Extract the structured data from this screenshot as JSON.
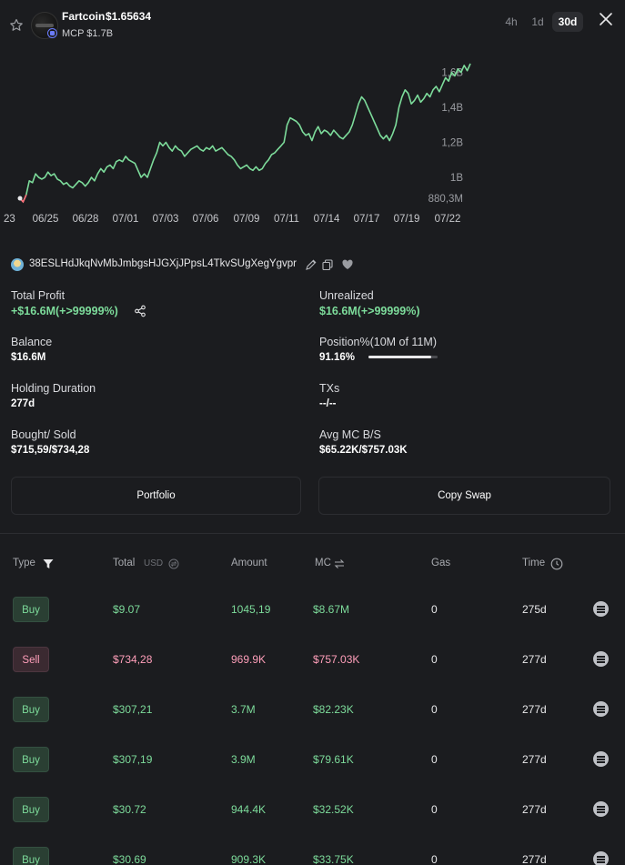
{
  "header": {
    "token_name": "Fartcoin",
    "price": "$1.65634",
    "mcp": "MCP $1.7B",
    "timeframes": [
      "4h",
      "1d",
      "30d"
    ],
    "active_timeframe": "30d"
  },
  "chart_data": {
    "type": "line",
    "x_ticks": [
      "23",
      "06/25",
      "06/28",
      "07/01",
      "07/03",
      "07/06",
      "07/09",
      "07/11",
      "07/14",
      "07/17",
      "07/19",
      "07/22"
    ],
    "y_ticks": [
      "1,6B",
      "1,4B",
      "1,2B",
      "1B",
      "880,3M"
    ],
    "ylim": [
      0.8803,
      1.65
    ],
    "line_color": "#7ddc9b",
    "start_color": "#ff6b7a",
    "values": [
      0.88,
      0.86,
      0.9,
      0.98,
      0.97,
      1.02,
      1.0,
      0.99,
      1.0,
      1.03,
      1.01,
      1.02,
      0.99,
      0.98,
      0.96,
      0.97,
      0.95,
      0.94,
      0.96,
      0.98,
      0.97,
      0.95,
      0.97,
      1.0,
      0.98,
      1.02,
      1.05,
      1.03,
      1.06,
      1.07,
      1.05,
      1.09,
      1.1,
      1.09,
      1.12,
      1.1,
      1.09,
      1.08,
      1.04,
      1.0,
      1.02,
      1.0,
      1.05,
      1.1,
      1.14,
      1.2,
      1.18,
      1.2,
      1.17,
      1.15,
      1.18,
      1.16,
      1.15,
      1.12,
      1.14,
      1.16,
      1.17,
      1.18,
      1.16,
      1.15,
      1.17,
      1.16,
      1.18,
      1.15,
      1.16,
      1.17,
      1.15,
      1.13,
      1.12,
      1.1,
      1.07,
      1.05,
      1.06,
      1.07,
      1.05,
      1.04,
      1.06,
      1.04,
      1.05,
      1.08,
      1.1,
      1.13,
      1.14,
      1.16,
      1.18,
      1.2,
      1.3,
      1.34,
      1.33,
      1.32,
      1.3,
      1.26,
      1.24,
      1.25,
      1.21,
      1.26,
      1.29,
      1.25,
      1.27,
      1.26,
      1.24,
      1.27,
      1.25,
      1.23,
      1.22,
      1.24,
      1.26,
      1.3,
      1.36,
      1.42,
      1.46,
      1.44,
      1.4,
      1.36,
      1.32,
      1.28,
      1.24,
      1.22,
      1.24,
      1.21,
      1.25,
      1.3,
      1.4,
      1.46,
      1.5,
      1.48,
      1.42,
      1.44,
      1.47,
      1.43,
      1.45,
      1.48,
      1.46,
      1.5,
      1.52,
      1.49,
      1.53,
      1.57,
      1.55,
      1.6,
      1.58,
      1.62,
      1.6,
      1.64,
      1.61,
      1.65
    ]
  },
  "wallet": {
    "address": "38ESLHdJkqNvMbJmbgsHJGXjJPpsL4TkvSUgXegYgvpr"
  },
  "stats": {
    "total_profit_label": "Total Profit",
    "total_profit_value": "+$16.6M(+>99999%)",
    "unrealized_label": "Unrealized",
    "unrealized_value": "$16.6M(+>99999%)",
    "balance_label": "Balance",
    "balance_value": "$16.6M",
    "position_label": "Position%(10M of 11M)",
    "position_value": "91.16%",
    "position_fraction": 0.9116,
    "holding_label": "Holding Duration",
    "holding_value": "277d",
    "txs_label": "TXs",
    "txs_value": "--/--",
    "bought_sold_label": "Bought/ Sold",
    "bought_sold_value": "$715,59/$734,28",
    "avg_mc_label": "Avg MC B/S",
    "avg_mc_value": "$65.22K/$757.03K"
  },
  "buttons": {
    "portfolio": "Portfolio",
    "copy_swap": "Copy Swap"
  },
  "table": {
    "headers": {
      "type": "Type",
      "total": "Total",
      "usd": "USD",
      "amount": "Amount",
      "mc": "MC",
      "gas": "Gas",
      "time": "Time"
    },
    "rows": [
      {
        "type": "Buy",
        "total": "$9.07",
        "amount": "1045,19",
        "mc": "$8.67M",
        "gas": "0",
        "time": "275d"
      },
      {
        "type": "Sell",
        "total": "$734,28",
        "amount": "969.9K",
        "mc": "$757.03K",
        "gas": "0",
        "time": "277d"
      },
      {
        "type": "Buy",
        "total": "$307,21",
        "amount": "3.7M",
        "mc": "$82.23K",
        "gas": "0",
        "time": "277d"
      },
      {
        "type": "Buy",
        "total": "$307,19",
        "amount": "3.9M",
        "mc": "$79.61K",
        "gas": "0",
        "time": "277d"
      },
      {
        "type": "Buy",
        "total": "$30.72",
        "amount": "944.4K",
        "mc": "$32.52K",
        "gas": "0",
        "time": "277d"
      },
      {
        "type": "Buy",
        "total": "$30.69",
        "amount": "909.3K",
        "mc": "$33.75K",
        "gas": "0",
        "time": "277d"
      }
    ]
  }
}
